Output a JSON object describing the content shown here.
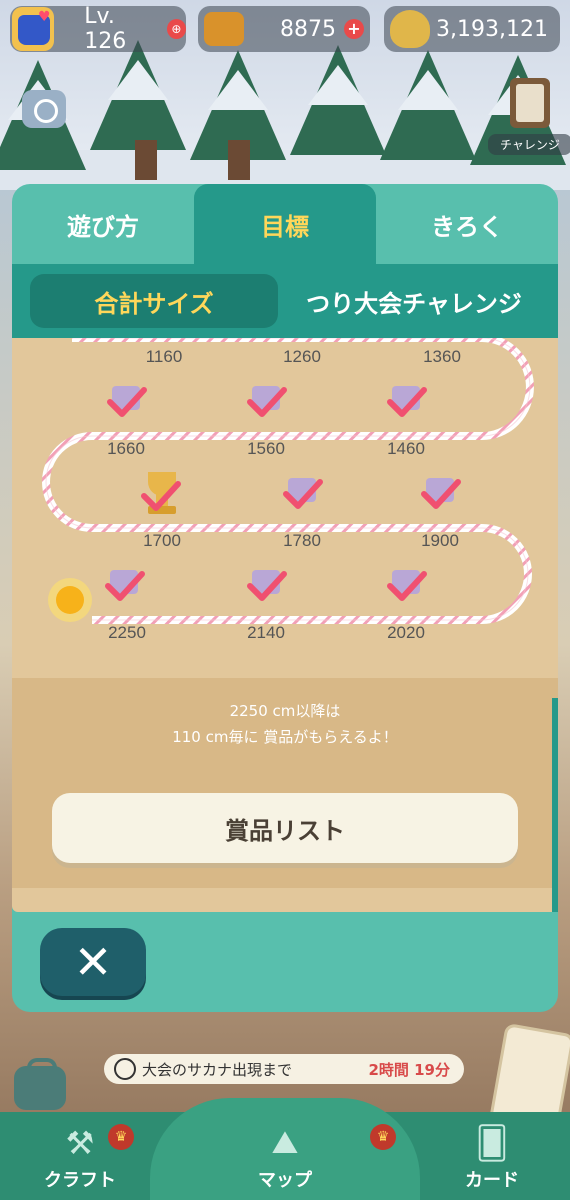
{
  "hud": {
    "level": "Lv. 126",
    "tickets": "8875",
    "bells": "3,193,121",
    "plus_icon_label": "+"
  },
  "side": {
    "challenge_label": "チャレンジ"
  },
  "panel": {
    "tabs": [
      {
        "label": "遊び方",
        "active": false
      },
      {
        "label": "目標",
        "active": true
      },
      {
        "label": "きろく",
        "active": false
      }
    ],
    "subtabs": [
      {
        "label": "合計サイズ",
        "active": true
      },
      {
        "label": "つり大会チャレンジ",
        "active": false
      }
    ],
    "milestones": {
      "row1": [
        "1160",
        "1260",
        "1360"
      ],
      "row2": [
        "1660",
        "1560",
        "1460"
      ],
      "row3": [
        "1700",
        "1780",
        "1900"
      ],
      "row4": [
        "2250",
        "2140",
        "2020"
      ]
    },
    "info_line1": "2250 cm以降は",
    "info_line2": "110 cm毎に 賞品がもらえるよ！",
    "prize_list_button": "賞品リスト",
    "close_label": "✕"
  },
  "timer": {
    "label": "大会のサカナ出現まで",
    "value": "2時間 19分"
  },
  "nav": {
    "craft": "クラフト",
    "map": "マップ",
    "card": "カード"
  },
  "colors": {
    "panel_teal": "#58bfad",
    "active_tab": "#25998a",
    "gold_text": "#ffd75a",
    "sand": "#e2c79b",
    "check_red": "#f05070",
    "gift_purple": "#b9a7d6"
  }
}
